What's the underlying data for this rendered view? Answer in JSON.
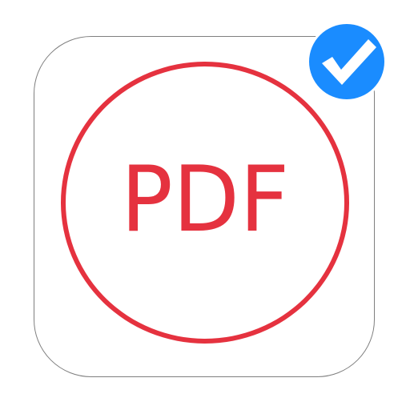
{
  "app_icon": {
    "label": "PDF",
    "accent_color": "#e5323f",
    "tile_border_color": "#7f7f7f",
    "badge": {
      "icon": "checkmark-icon",
      "fill_color": "#1a8cff",
      "ring_color": "#ffffff"
    }
  }
}
